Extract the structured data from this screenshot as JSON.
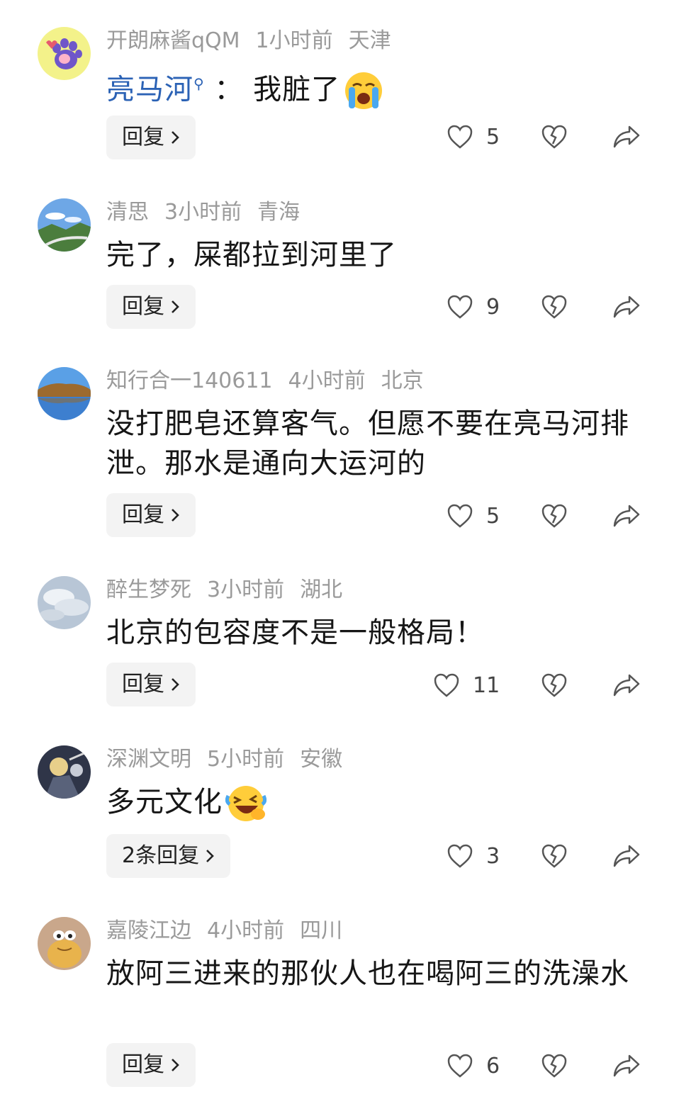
{
  "comments": [
    {
      "user": "开朗麻酱qQM",
      "time": "1小时前",
      "location": "天津",
      "mention": "亮马河",
      "separator": "：",
      "text": "我脏了",
      "emoji": "crying-face",
      "reply_label": "回复",
      "likes": "5"
    },
    {
      "user": "清思",
      "time": "3小时前",
      "location": "青海",
      "text": "完了，屎都拉到河里了",
      "reply_label": "回复",
      "likes": "9"
    },
    {
      "user": "知行合一140611",
      "time": "4小时前",
      "location": "北京",
      "text": "没打肥皂还算客气。但愿不要在亮马河排泄。那水是通向大运河的",
      "reply_label": "回复",
      "likes": "5"
    },
    {
      "user": "醉生梦死",
      "time": "3小时前",
      "location": "湖北",
      "text": "北京的包容度不是一般格局！",
      "reply_label": "回复",
      "likes": "11"
    },
    {
      "user": "深渊文明",
      "time": "5小时前",
      "location": "安徽",
      "text": "多元文化",
      "emoji": "laughing-crying-face",
      "reply_label": "2条回复",
      "likes": "3"
    },
    {
      "user": "嘉陵江边",
      "time": "4小时前",
      "location": "四川",
      "text": "放阿三进来的那伙人也在喝阿三的洗澡水",
      "reply_label": "回复",
      "likes": "6"
    }
  ],
  "colors": {
    "meta": "#9a9a9a",
    "mention": "#2b62b5",
    "reply_bg": "#f3f3f3",
    "icon_stroke": "#555555"
  }
}
